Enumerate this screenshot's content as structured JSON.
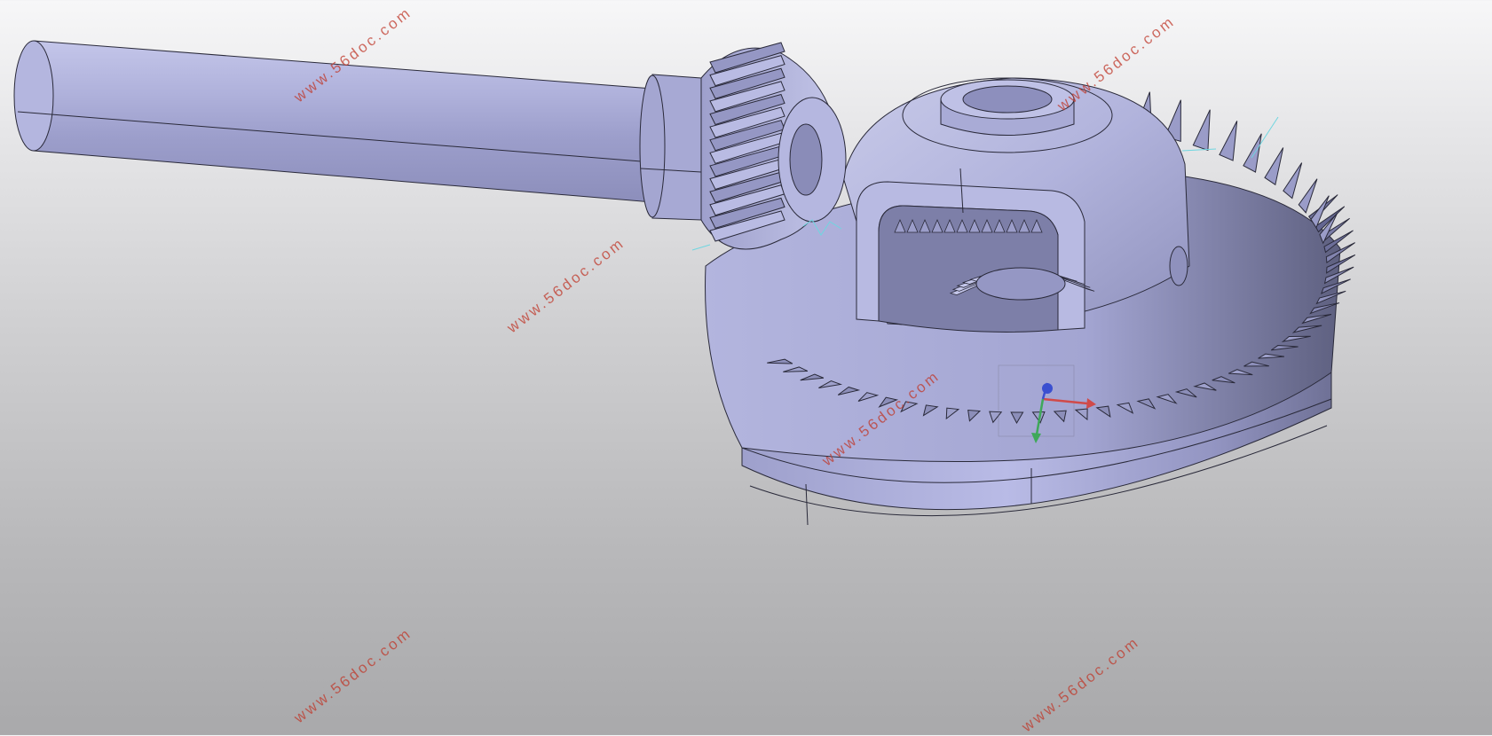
{
  "viewport": {
    "background_top": "#f7f7f8",
    "background_bottom": "#a9a9ab",
    "part_color": "#a9abd4",
    "edge_color": "#2a2a3a",
    "watermark_color": "#c0392b"
  },
  "watermarks": [
    "www.56doc.com",
    "www.56doc.com",
    "www.56doc.com",
    "www.56doc.com",
    "www.56doc.com",
    "www.56doc.com"
  ],
  "model": {
    "parts": [
      "shaft",
      "pinion-gear",
      "ring-gear",
      "differential-housing",
      "side-gears"
    ]
  },
  "icons": {
    "triad": "axis-triad-icon",
    "csys": "coordinate-system-icon"
  }
}
